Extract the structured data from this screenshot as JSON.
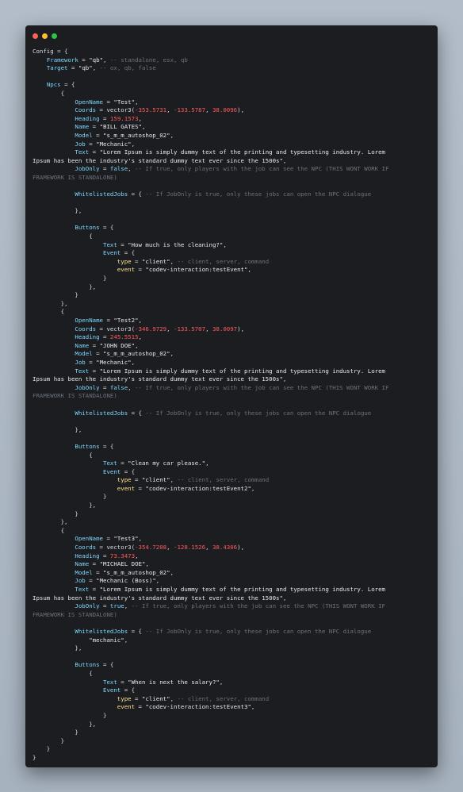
{
  "window": {
    "traffic_lights": [
      {
        "name": "close",
        "color": "#ff5f57"
      },
      {
        "name": "minimize",
        "color": "#febc2e"
      },
      {
        "name": "maximize",
        "color": "#28c840"
      }
    ]
  },
  "code_lines": [
    [
      [
        "p",
        "Config = {"
      ]
    ],
    [
      [
        "p",
        "    "
      ],
      [
        "id",
        "Framework"
      ],
      [
        "p",
        " = "
      ],
      [
        "str",
        "\"qb\""
      ],
      [
        "p",
        ", "
      ],
      [
        "cm",
        "-- standalone, esx, qb"
      ]
    ],
    [
      [
        "p",
        "    "
      ],
      [
        "id",
        "Target"
      ],
      [
        "p",
        " = "
      ],
      [
        "str",
        "\"qb\""
      ],
      [
        "p",
        ", "
      ],
      [
        "cm",
        "-- ox, qb, false"
      ]
    ],
    [
      [
        "p",
        ""
      ]
    ],
    [
      [
        "p",
        "    "
      ],
      [
        "id",
        "Npcs"
      ],
      [
        "p",
        " = {"
      ]
    ],
    [
      [
        "p",
        "        {"
      ]
    ],
    [
      [
        "p",
        "            "
      ],
      [
        "id",
        "OpenName"
      ],
      [
        "p",
        " = "
      ],
      [
        "str",
        "\"Test\""
      ],
      [
        "p",
        ","
      ]
    ],
    [
      [
        "p",
        "            "
      ],
      [
        "id",
        "Coords"
      ],
      [
        "p",
        " = vector3("
      ],
      [
        "num",
        "-353.5731"
      ],
      [
        "p",
        ", "
      ],
      [
        "num",
        "-133.5787"
      ],
      [
        "p",
        ", "
      ],
      [
        "num",
        "38.0096"
      ],
      [
        "p",
        "),"
      ]
    ],
    [
      [
        "p",
        "            "
      ],
      [
        "id",
        "Heading"
      ],
      [
        "p",
        " = "
      ],
      [
        "num",
        "159.1573"
      ],
      [
        "p",
        ","
      ]
    ],
    [
      [
        "p",
        "            "
      ],
      [
        "id",
        "Name"
      ],
      [
        "p",
        " = "
      ],
      [
        "str",
        "\"BILL GATES\""
      ],
      [
        "p",
        ","
      ]
    ],
    [
      [
        "p",
        "            "
      ],
      [
        "id",
        "Model"
      ],
      [
        "p",
        " = "
      ],
      [
        "str",
        "\"s_m_m_autoshop_02\""
      ],
      [
        "p",
        ","
      ]
    ],
    [
      [
        "p",
        "            "
      ],
      [
        "id",
        "Job"
      ],
      [
        "p",
        " = "
      ],
      [
        "str",
        "\"Mechanic\""
      ],
      [
        "p",
        ","
      ]
    ],
    [
      [
        "p",
        "            "
      ],
      [
        "id",
        "Text"
      ],
      [
        "p",
        " = "
      ],
      [
        "str",
        "\"Lorem Ipsum is simply dummy text of the printing and typesetting industry. Lorem"
      ]
    ],
    [
      [
        "str",
        "Ipsum has been the industry's standard dummy text ever since the 1500s\""
      ],
      [
        "p",
        ","
      ]
    ],
    [
      [
        "p",
        "            "
      ],
      [
        "id",
        "JobOnly"
      ],
      [
        "p",
        " = "
      ],
      [
        "kw",
        "false"
      ],
      [
        "p",
        ", "
      ],
      [
        "cm",
        "-- If true, only players with the job can see the NPC (THIS WONT WORK IF"
      ]
    ],
    [
      [
        "cm",
        "FRAMEWORK IS STANDALONE)"
      ]
    ],
    [
      [
        "p",
        ""
      ]
    ],
    [
      [
        "p",
        "            "
      ],
      [
        "id",
        "WhitelistedJobs"
      ],
      [
        "p",
        " = { "
      ],
      [
        "cm",
        "-- If JobOnly is true, only these jobs can open the NPC dialogue"
      ]
    ],
    [
      [
        "p",
        ""
      ]
    ],
    [
      [
        "p",
        "            },"
      ]
    ],
    [
      [
        "p",
        ""
      ]
    ],
    [
      [
        "p",
        "            "
      ],
      [
        "id",
        "Buttons"
      ],
      [
        "p",
        " = {"
      ]
    ],
    [
      [
        "p",
        "                {"
      ]
    ],
    [
      [
        "p",
        "                    "
      ],
      [
        "id",
        "Text"
      ],
      [
        "p",
        " = "
      ],
      [
        "str",
        "\"How much is the cleaning?\""
      ],
      [
        "p",
        ","
      ]
    ],
    [
      [
        "p",
        "                    "
      ],
      [
        "id",
        "Event"
      ],
      [
        "p",
        " = {"
      ]
    ],
    [
      [
        "p",
        "                        "
      ],
      [
        "key",
        "type"
      ],
      [
        "p",
        " = "
      ],
      [
        "str",
        "\"client\""
      ],
      [
        "p",
        ", "
      ],
      [
        "cm",
        "-- client, server, command"
      ]
    ],
    [
      [
        "p",
        "                        "
      ],
      [
        "key",
        "event"
      ],
      [
        "p",
        " = "
      ],
      [
        "str",
        "\"codev-interaction:testEvent\""
      ],
      [
        "p",
        ","
      ]
    ],
    [
      [
        "p",
        "                    }"
      ]
    ],
    [
      [
        "p",
        "                },"
      ]
    ],
    [
      [
        "p",
        "            }"
      ]
    ],
    [
      [
        "p",
        "        },"
      ]
    ],
    [
      [
        "p",
        "        {"
      ]
    ],
    [
      [
        "p",
        "            "
      ],
      [
        "id",
        "OpenName"
      ],
      [
        "p",
        " = "
      ],
      [
        "str",
        "\"Test2\""
      ],
      [
        "p",
        ","
      ]
    ],
    [
      [
        "p",
        "            "
      ],
      [
        "id",
        "Coords"
      ],
      [
        "p",
        " = vector3("
      ],
      [
        "num",
        "-346.9729"
      ],
      [
        "p",
        ", "
      ],
      [
        "num",
        "-133.5707"
      ],
      [
        "p",
        ", "
      ],
      [
        "num",
        "38.0097"
      ],
      [
        "p",
        "),"
      ]
    ],
    [
      [
        "p",
        "            "
      ],
      [
        "id",
        "Heading"
      ],
      [
        "p",
        " = "
      ],
      [
        "num",
        "245.5515"
      ],
      [
        "p",
        ","
      ]
    ],
    [
      [
        "p",
        "            "
      ],
      [
        "id",
        "Name"
      ],
      [
        "p",
        " = "
      ],
      [
        "str",
        "\"JOHN DOE\""
      ],
      [
        "p",
        ","
      ]
    ],
    [
      [
        "p",
        "            "
      ],
      [
        "id",
        "Model"
      ],
      [
        "p",
        " = "
      ],
      [
        "str",
        "\"s_m_m_autoshop_02\""
      ],
      [
        "p",
        ","
      ]
    ],
    [
      [
        "p",
        "            "
      ],
      [
        "id",
        "Job"
      ],
      [
        "p",
        " = "
      ],
      [
        "str",
        "\"Mechanic\""
      ],
      [
        "p",
        ","
      ]
    ],
    [
      [
        "p",
        "            "
      ],
      [
        "id",
        "Text"
      ],
      [
        "p",
        " = "
      ],
      [
        "str",
        "\"Lorem Ipsum is simply dummy text of the printing and typesetting industry. Lorem"
      ]
    ],
    [
      [
        "str",
        "Ipsum has been the industry's standard dummy text ever since the 1500s\""
      ],
      [
        "p",
        ","
      ]
    ],
    [
      [
        "p",
        "            "
      ],
      [
        "id",
        "JobOnly"
      ],
      [
        "p",
        " = "
      ],
      [
        "kw",
        "false"
      ],
      [
        "p",
        ", "
      ],
      [
        "cm",
        "-- If true, only players with the job can see the NPC (THIS WONT WORK IF"
      ]
    ],
    [
      [
        "cm",
        "FRAMEWORK IS STANDALONE)"
      ]
    ],
    [
      [
        "p",
        ""
      ]
    ],
    [
      [
        "p",
        "            "
      ],
      [
        "id",
        "WhitelistedJobs"
      ],
      [
        "p",
        " = { "
      ],
      [
        "cm",
        "-- If JobOnly is true, only these jobs can open the NPC dialogue"
      ]
    ],
    [
      [
        "p",
        ""
      ]
    ],
    [
      [
        "p",
        "            },"
      ]
    ],
    [
      [
        "p",
        ""
      ]
    ],
    [
      [
        "p",
        "            "
      ],
      [
        "id",
        "Buttons"
      ],
      [
        "p",
        " = {"
      ]
    ],
    [
      [
        "p",
        "                {"
      ]
    ],
    [
      [
        "p",
        "                    "
      ],
      [
        "id",
        "Text"
      ],
      [
        "p",
        " = "
      ],
      [
        "str",
        "\"Clean my car please.\""
      ],
      [
        "p",
        ","
      ]
    ],
    [
      [
        "p",
        "                    "
      ],
      [
        "id",
        "Event"
      ],
      [
        "p",
        " = {"
      ]
    ],
    [
      [
        "p",
        "                        "
      ],
      [
        "key",
        "type"
      ],
      [
        "p",
        " = "
      ],
      [
        "str",
        "\"client\""
      ],
      [
        "p",
        ", "
      ],
      [
        "cm",
        "-- client, server, command"
      ]
    ],
    [
      [
        "p",
        "                        "
      ],
      [
        "key",
        "event"
      ],
      [
        "p",
        " = "
      ],
      [
        "str",
        "\"codev-interaction:testEvent2\""
      ],
      [
        "p",
        ","
      ]
    ],
    [
      [
        "p",
        "                    }"
      ]
    ],
    [
      [
        "p",
        "                },"
      ]
    ],
    [
      [
        "p",
        "            }"
      ]
    ],
    [
      [
        "p",
        "        },"
      ]
    ],
    [
      [
        "p",
        "        {"
      ]
    ],
    [
      [
        "p",
        "            "
      ],
      [
        "id",
        "OpenName"
      ],
      [
        "p",
        " = "
      ],
      [
        "str",
        "\"Test3\""
      ],
      [
        "p",
        ","
      ]
    ],
    [
      [
        "p",
        "            "
      ],
      [
        "id",
        "Coords"
      ],
      [
        "p",
        " = vector3("
      ],
      [
        "num",
        "-354.7208"
      ],
      [
        "p",
        ", "
      ],
      [
        "num",
        "-128.1526"
      ],
      [
        "p",
        ", "
      ],
      [
        "num",
        "38.4306"
      ],
      [
        "p",
        "),"
      ]
    ],
    [
      [
        "p",
        "            "
      ],
      [
        "id",
        "Heading"
      ],
      [
        "p",
        " = "
      ],
      [
        "num",
        "73.3473"
      ],
      [
        "p",
        ","
      ]
    ],
    [
      [
        "p",
        "            "
      ],
      [
        "id",
        "Name"
      ],
      [
        "p",
        " = "
      ],
      [
        "str",
        "\"MICHAEL DOE\""
      ],
      [
        "p",
        ","
      ]
    ],
    [
      [
        "p",
        "            "
      ],
      [
        "id",
        "Model"
      ],
      [
        "p",
        " = "
      ],
      [
        "str",
        "\"s_m_m_autoshop_02\""
      ],
      [
        "p",
        ","
      ]
    ],
    [
      [
        "p",
        "            "
      ],
      [
        "id",
        "Job"
      ],
      [
        "p",
        " = "
      ],
      [
        "str",
        "\"Mechanic (Boss)\""
      ],
      [
        "p",
        ","
      ]
    ],
    [
      [
        "p",
        "            "
      ],
      [
        "id",
        "Text"
      ],
      [
        "p",
        " = "
      ],
      [
        "str",
        "\"Lorem Ipsum is simply dummy text of the printing and typesetting industry. Lorem"
      ]
    ],
    [
      [
        "str",
        "Ipsum has been the industry's standard dummy text ever since the 1500s\""
      ],
      [
        "p",
        ","
      ]
    ],
    [
      [
        "p",
        "            "
      ],
      [
        "id",
        "JobOnly"
      ],
      [
        "p",
        " = "
      ],
      [
        "kw",
        "true"
      ],
      [
        "p",
        ", "
      ],
      [
        "cm",
        "-- If true, only players with the job can see the NPC (THIS WONT WORK IF"
      ]
    ],
    [
      [
        "cm",
        "FRAMEWORK IS STANDALONE)"
      ]
    ],
    [
      [
        "p",
        ""
      ]
    ],
    [
      [
        "p",
        "            "
      ],
      [
        "id",
        "WhitelistedJobs"
      ],
      [
        "p",
        " = { "
      ],
      [
        "cm",
        "-- If JobOnly is true, only these jobs can open the NPC dialogue"
      ]
    ],
    [
      [
        "p",
        "                "
      ],
      [
        "str",
        "\"mechanic\""
      ],
      [
        "p",
        ","
      ]
    ],
    [
      [
        "p",
        "            },"
      ]
    ],
    [
      [
        "p",
        ""
      ]
    ],
    [
      [
        "p",
        "            "
      ],
      [
        "id",
        "Buttons"
      ],
      [
        "p",
        " = {"
      ]
    ],
    [
      [
        "p",
        "                {"
      ]
    ],
    [
      [
        "p",
        "                    "
      ],
      [
        "id",
        "Text"
      ],
      [
        "p",
        " = "
      ],
      [
        "str",
        "\"When is next the salary?\""
      ],
      [
        "p",
        ","
      ]
    ],
    [
      [
        "p",
        "                    "
      ],
      [
        "id",
        "Event"
      ],
      [
        "p",
        " = {"
      ]
    ],
    [
      [
        "p",
        "                        "
      ],
      [
        "key",
        "type"
      ],
      [
        "p",
        " = "
      ],
      [
        "str",
        "\"client\""
      ],
      [
        "p",
        ", "
      ],
      [
        "cm",
        "-- client, server, command"
      ]
    ],
    [
      [
        "p",
        "                        "
      ],
      [
        "key",
        "event"
      ],
      [
        "p",
        " = "
      ],
      [
        "str",
        "\"codev-interaction:testEvent3\""
      ],
      [
        "p",
        ","
      ]
    ],
    [
      [
        "p",
        "                    }"
      ]
    ],
    [
      [
        "p",
        "                },"
      ]
    ],
    [
      [
        "p",
        "            }"
      ]
    ],
    [
      [
        "p",
        "        }"
      ]
    ],
    [
      [
        "p",
        "    }"
      ]
    ],
    [
      [
        "p",
        "}"
      ]
    ]
  ]
}
